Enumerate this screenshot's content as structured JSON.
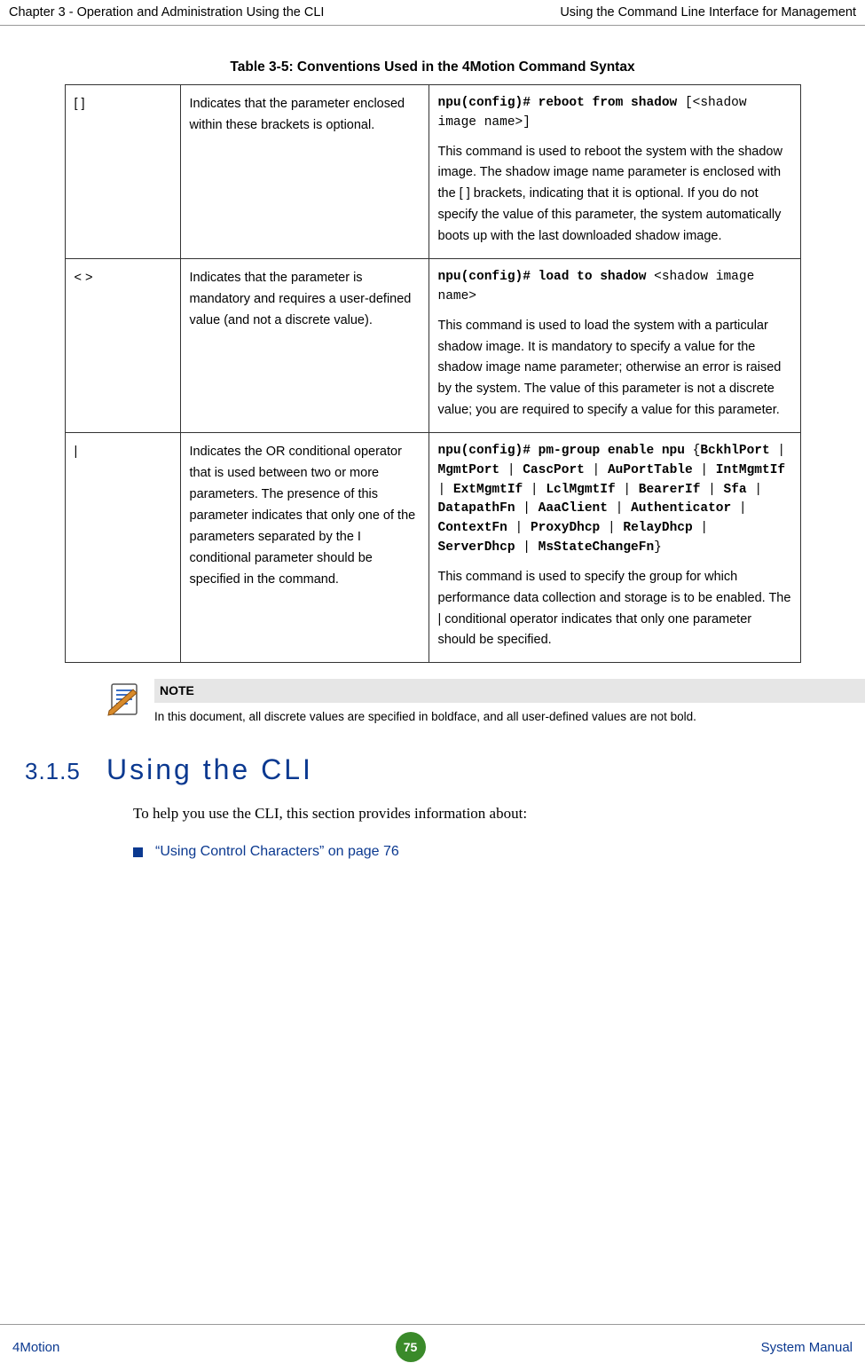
{
  "header": {
    "left": "Chapter 3 - Operation and Administration Using the CLI",
    "right": "Using the Command Line Interface for Management"
  },
  "table": {
    "caption": "Table 3-5: Conventions Used in the 4Motion Command Syntax",
    "rows": [
      {
        "symbol": "[ ]",
        "meaning": "Indicates that the parameter enclosed within these brackets is optional.",
        "code_bold": "npu(config)# reboot from shadow",
        "code_rest": "[<shadow image name>]",
        "desc": "This command is used to reboot the system with the shadow image. The shadow image name parameter is enclosed with the [ ] brackets, indicating that it is optional. If you do not specify the value of this parameter, the system automatically boots up with the last downloaded shadow image."
      },
      {
        "symbol": "< >",
        "meaning": "Indicates that the parameter is mandatory and requires a user-defined value (and not a discrete value).",
        "code_bold": "npu(config)# load to shadow",
        "code_rest": "<shadow image name>",
        "desc": "This command is used to load the system with a particular shadow image. It is mandatory to specify a value for the shadow image name parameter; otherwise an error is raised by the system. The value of this parameter is not a discrete value; you are required to specify a value for this parameter."
      },
      {
        "symbol": "|",
        "meaning": "Indicates the OR conditional operator that is used between two or more parameters. The presence of this parameter indicates that only one of the parameters separated by the I conditional parameter should be specified in the command.",
        "code_full_html": "<b>npu(config)# pm-group enable npu</b> {<b>BckhlPort</b> | <b>MgmtPort</b> | <b>CascPort</b> | <b>AuPortTable</b> | <b>IntMgmtIf</b> | <b>ExtMgmtIf</b> | <b>LclMgmtIf</b> | <b>BearerIf</b> | <b>Sfa</b> | <b>DatapathFn</b> | <b>AaaClient</b> | <b>Authenticator</b> | <b>ContextFn</b> | <b>ProxyDhcp</b> | <b>RelayDhcp</b> | <b>ServerDhcp</b> | <b>MsStateChangeFn</b>}",
        "desc": "This command is used to specify the group for which performance data collection and storage is to be enabled. The | conditional operator indicates that only one parameter should be specified."
      }
    ]
  },
  "note": {
    "title": "NOTE",
    "text": "In this document, all discrete values are specified in boldface, and all user-defined values are not bold."
  },
  "section": {
    "num": "3.1.5",
    "title": "Using the CLI",
    "intro": "To help you use the CLI, this section provides information about:",
    "link": "“Using Control Characters” on page 76"
  },
  "footer": {
    "left": "4Motion",
    "page": "75",
    "right": "System Manual"
  }
}
